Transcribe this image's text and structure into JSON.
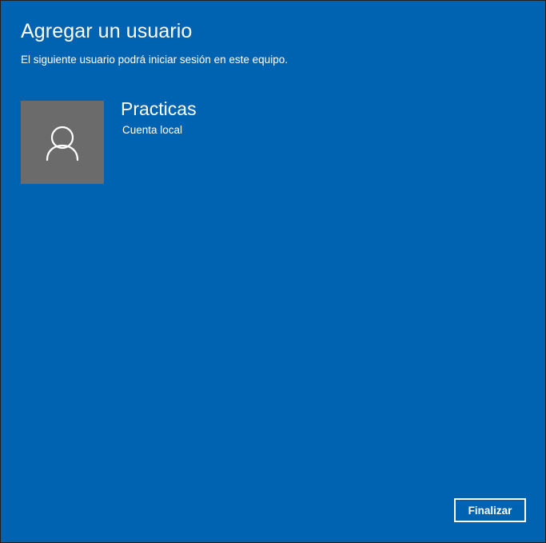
{
  "dialog": {
    "title": "Agregar un usuario",
    "subtitle": "El siguiente usuario podrá iniciar sesión en este equipo."
  },
  "user": {
    "name": "Practicas",
    "account_type": "Cuenta local",
    "avatar_icon": "person-icon"
  },
  "actions": {
    "finish_label": "Finalizar"
  },
  "colors": {
    "background": "#0063b1",
    "avatar_background": "#6b6b6b",
    "text": "#ffffff"
  }
}
